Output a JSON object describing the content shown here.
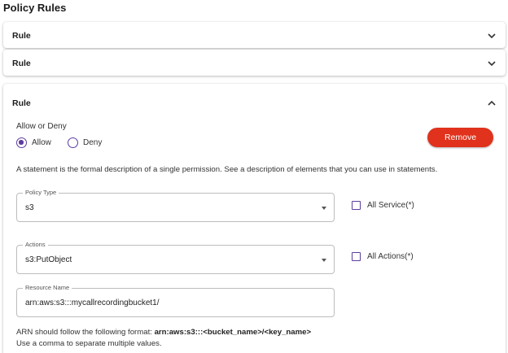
{
  "page": {
    "title": "Policy Rules"
  },
  "rules": [
    {
      "title": "Rule"
    },
    {
      "title": "Rule"
    },
    {
      "title": "Rule",
      "effect": {
        "label": "Allow or Deny",
        "options": [
          "Allow",
          "Deny"
        ],
        "selected": "Allow"
      },
      "remove_label": "Remove",
      "description": "A statement is the formal description of a single permission. See a description of elements that you can use in statements.",
      "policy_type": {
        "label": "Policy Type",
        "value": "s3",
        "all_label": "All Service(*)"
      },
      "actions": {
        "label": "Actions",
        "value": "s3:PutObject",
        "all_label": "All Actions(*)"
      },
      "resource": {
        "label": "Resource Name",
        "value": "arn:aws:s3:::mycallrecordingbucket1/"
      },
      "help": {
        "arn_prefix": "ARN should follow the following format: ",
        "arn_format": "arn:aws:s3:::<bucket_name>/<key_name>",
        "comma_note": "Use a comma to separate multiple values."
      }
    }
  ],
  "colors": {
    "accent": "#5c3d9e",
    "remove": "#e0321c"
  },
  "icons": {
    "collapsed": "chevron-down-icon",
    "expanded": "chevron-up-icon",
    "dropdown": "caret-down-icon"
  }
}
